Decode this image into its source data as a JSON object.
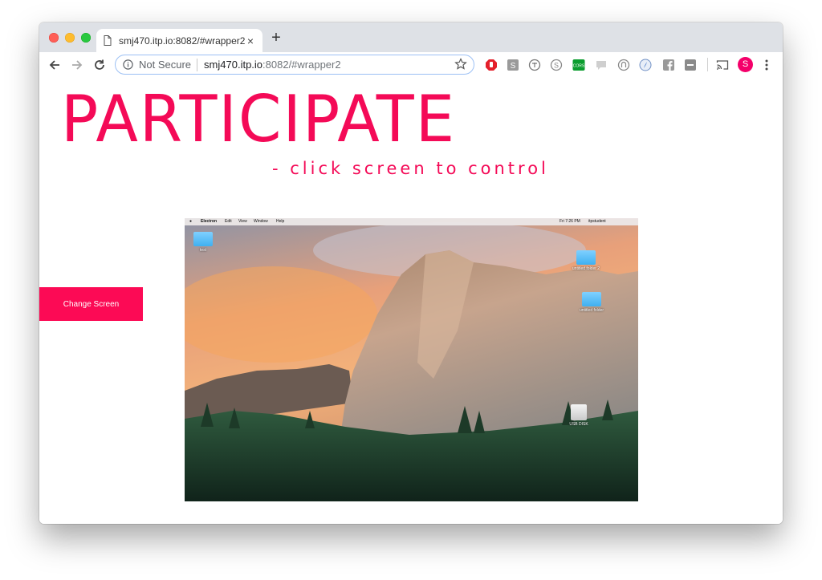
{
  "browser": {
    "tab_title": "smj470.itp.io:8082/#wrapper2",
    "tab_close": "×",
    "new_tab": "+",
    "security_label": "Not Secure",
    "url_host": "smj470.itp.io",
    "url_rest": ":8082/#wrapper2",
    "avatar_letter": "S",
    "accent_color": "#1a73e8",
    "extensions": [
      "adblock-icon",
      "s-extension-icon",
      "translate-icon",
      "skype-icon",
      "cors-icon",
      "comment-icon",
      "ghostery-icon",
      "compass-icon",
      "facebook-icon",
      "minus-extension-icon",
      "cast-icon"
    ]
  },
  "page": {
    "headline": "PARTICIPATE",
    "subtitle": "- click screen to control",
    "button_label": "Change Screen",
    "brand_color": "#f40a57"
  },
  "remote_screen": {
    "menubar_app": "Electron",
    "menu_items": [
      "Edit",
      "View",
      "Window",
      "Help"
    ],
    "menubar_clock": "Fri 7:26 PM",
    "menubar_user": "itpstudent",
    "desktop_icons": [
      "test",
      "untitled folder 2",
      "untitled folder",
      "USB DISK"
    ]
  }
}
